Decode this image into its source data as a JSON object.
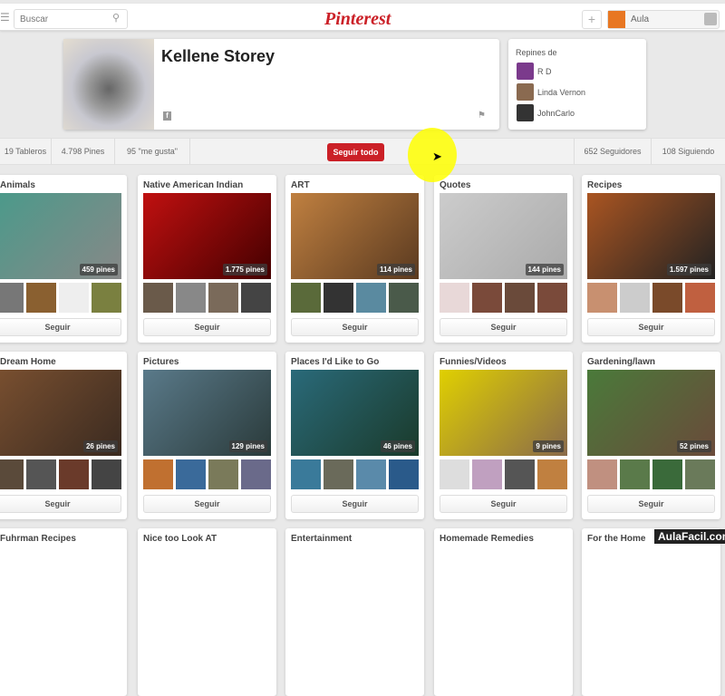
{
  "header": {
    "search_placeholder": "Buscar",
    "logo": "Pinterest",
    "user_name": "Aula"
  },
  "profile": {
    "name": "Kellene Storey"
  },
  "repins": {
    "title": "Repines de",
    "users": [
      {
        "name": "R D",
        "color": "#7b3a8c"
      },
      {
        "name": "Linda Vernon",
        "color": "#8a6a50"
      },
      {
        "name": "JohnCarlo",
        "color": "#333"
      }
    ]
  },
  "stats": {
    "boards": "19 Tableros",
    "pins": "4.798 Pines",
    "likes": "95 \"me gusta\"",
    "follow_all": "Seguir todo",
    "followers": "652 Seguidores",
    "following": "108 Siguiendo"
  },
  "accent_color": "#cb2027",
  "follow_label": "Seguir",
  "boards": [
    {
      "title": "Animals",
      "count": "459 pines",
      "colors": [
        "#4a9a8a",
        "#888"
      ],
      "thumbs": [
        "#777",
        "#8a6030",
        "#eee",
        "#7a8040"
      ]
    },
    {
      "title": "Native American Indian",
      "count": "1.775 pines",
      "colors": [
        "#c01010",
        "#400"
      ],
      "thumbs": [
        "#6a5a4a",
        "#888",
        "#7a6a5a",
        "#444"
      ]
    },
    {
      "title": "ART",
      "count": "114 pines",
      "colors": [
        "#c08040",
        "#5a3a20"
      ],
      "thumbs": [
        "#5a6a3a",
        "#333",
        "#5a8aa0",
        "#4a5a4a"
      ]
    },
    {
      "title": "Quotes",
      "count": "144 pines",
      "colors": [
        "#ccc",
        "#aaa"
      ],
      "thumbs": [
        "#e8d8d8",
        "#7a4a3a",
        "#6a4a3a",
        "#7a4a3a"
      ]
    },
    {
      "title": "Recipes",
      "count": "1.597 pines",
      "colors": [
        "#aa5522",
        "#222"
      ],
      "thumbs": [
        "#c89070",
        "#ccc",
        "#7a4a2a",
        "#c06040"
      ]
    },
    {
      "title": "Dream Home",
      "count": "26 pines",
      "colors": [
        "#7a5030",
        "#3a2a20"
      ],
      "thumbs": [
        "#5a4a3a",
        "#555",
        "#6a3a2a",
        "#444"
      ]
    },
    {
      "title": "Pictures",
      "count": "129 pines",
      "colors": [
        "#5a7a8a",
        "#2a3a3a"
      ],
      "thumbs": [
        "#c07030",
        "#3a6a9a",
        "#7a7a5a",
        "#6a6a8a"
      ]
    },
    {
      "title": "Places I'd Like to Go",
      "count": "46 pines",
      "colors": [
        "#2a6a7a",
        "#1a3a2a"
      ],
      "thumbs": [
        "#3a7a9a",
        "#6a6a5a",
        "#5a8aaa",
        "#2a5a8a"
      ]
    },
    {
      "title": "Funnies/Videos",
      "count": "9 pines",
      "colors": [
        "#e0d000",
        "#8a6a4a"
      ],
      "thumbs": [
        "#ddd",
        "#c0a0c0",
        "#555",
        "#c08040"
      ]
    },
    {
      "title": "Gardening/lawn",
      "count": "52 pines",
      "colors": [
        "#4a7a3a",
        "#6a4a3a"
      ],
      "thumbs": [
        "#c09080",
        "#5a7a4a",
        "#3a6a3a",
        "#6a7a5a"
      ]
    },
    {
      "title": "Fuhrman Recipes"
    },
    {
      "title": "Nice too Look AT"
    },
    {
      "title": "Entertainment"
    },
    {
      "title": "Homemade Remedies"
    },
    {
      "title": "For the Home"
    }
  ],
  "watermark": "AulaFacil.com"
}
